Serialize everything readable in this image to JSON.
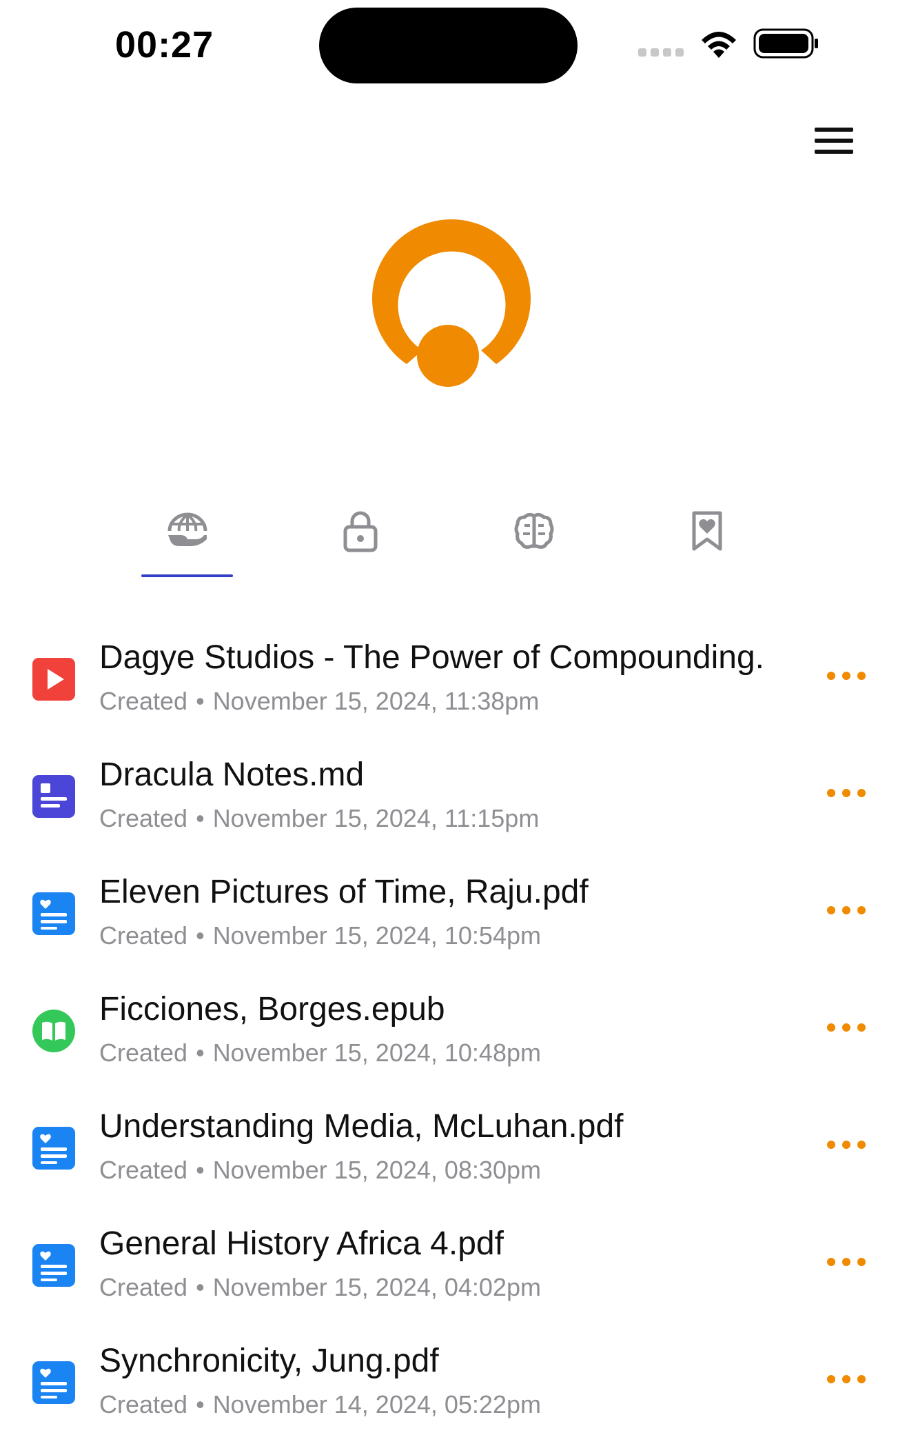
{
  "status_bar": {
    "time": "00:27"
  },
  "colors": {
    "accent": "#f08a00",
    "tab_underline": "#3340c8",
    "video": "#f0413a",
    "markdown": "#4b46d8",
    "pdf": "#1a84f2",
    "epub": "#34c759"
  },
  "header": {
    "menu_icon": "hamburger-menu-icon",
    "logo_icon": "orange-circle-logo"
  },
  "tabs": [
    {
      "icon": "globe-hand-icon",
      "active": true
    },
    {
      "icon": "lock-icon",
      "active": false
    },
    {
      "icon": "brain-icon",
      "active": false
    },
    {
      "icon": "bookmark-heart-icon",
      "active": false
    }
  ],
  "files": [
    {
      "title": "Dagye Studios - The Power of Compounding.",
      "status": "Created",
      "date": "November 15, 2024, 11:38pm",
      "type": "video"
    },
    {
      "title": "Dracula Notes.md",
      "status": "Created",
      "date": "November 15, 2024, 11:15pm",
      "type": "markdown"
    },
    {
      "title": "Eleven Pictures of Time, Raju.pdf",
      "status": "Created",
      "date": "November 15, 2024, 10:54pm",
      "type": "pdf"
    },
    {
      "title": "Ficciones, Borges.epub",
      "status": "Created",
      "date": "November 15, 2024, 10:48pm",
      "type": "epub"
    },
    {
      "title": "Understanding Media, McLuhan.pdf",
      "status": "Created",
      "date": "November 15, 2024, 08:30pm",
      "type": "pdf"
    },
    {
      "title": "General History Africa 4.pdf",
      "status": "Created",
      "date": "November 15, 2024, 04:02pm",
      "type": "pdf"
    },
    {
      "title": "Synchronicity, Jung.pdf",
      "status": "Created",
      "date": "November 14, 2024, 05:22pm",
      "type": "pdf"
    }
  ]
}
